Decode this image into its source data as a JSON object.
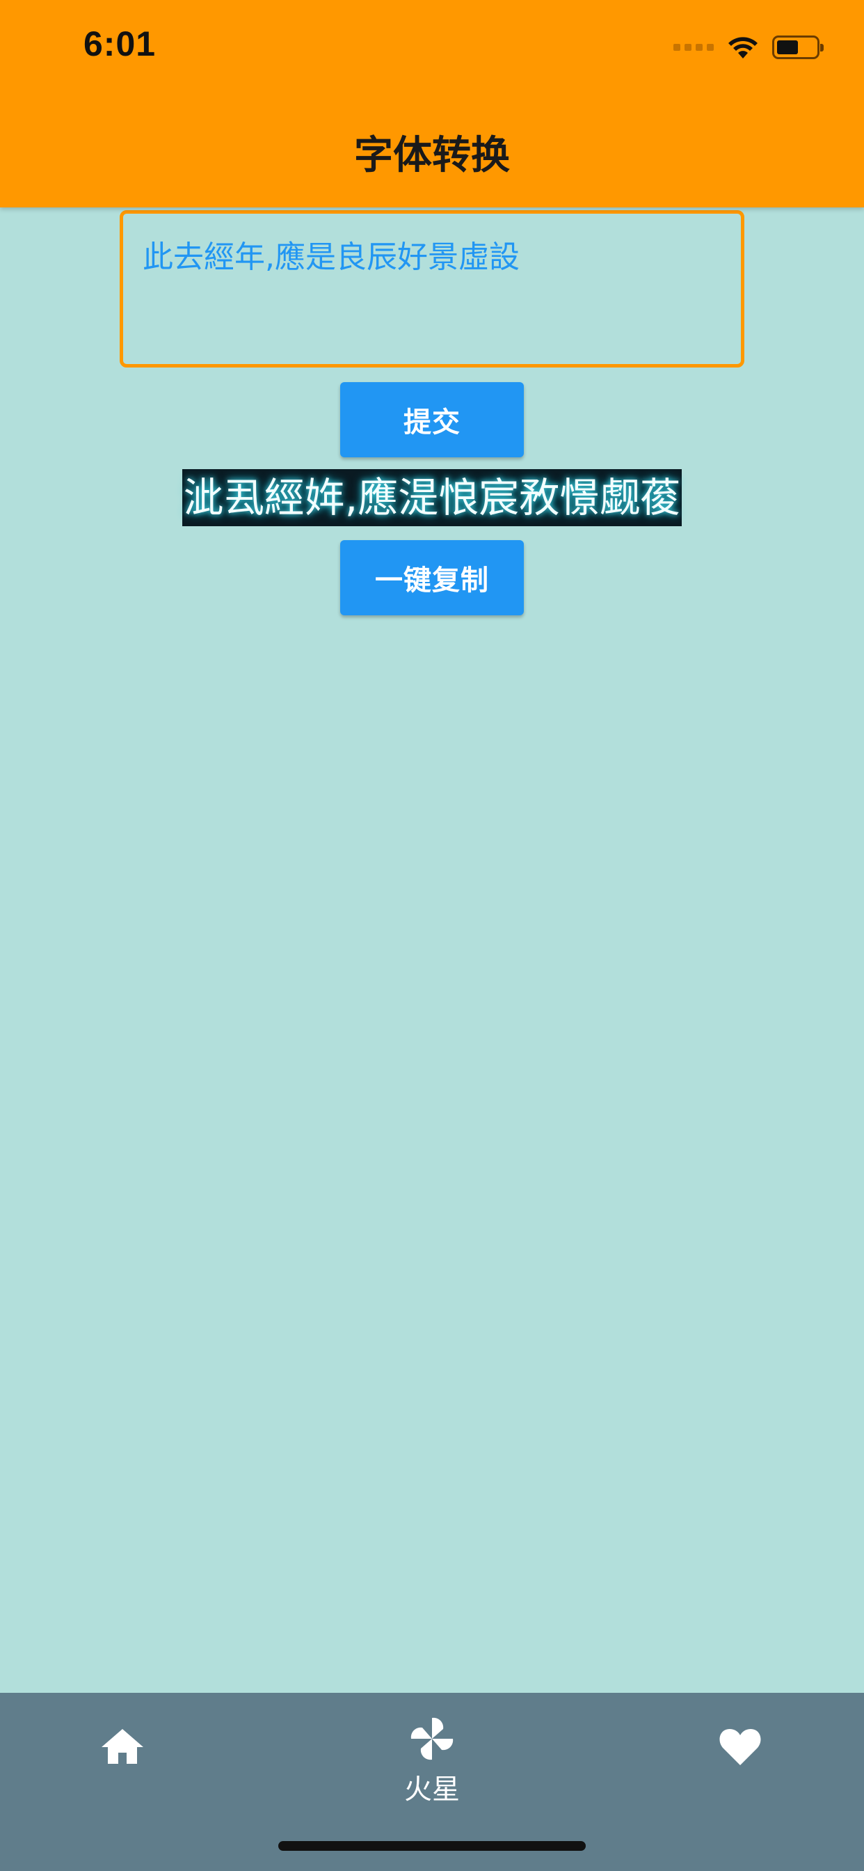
{
  "status_bar": {
    "time": "6:01",
    "icons": [
      "signal-dots-icon",
      "wifi-icon",
      "battery-icon"
    ]
  },
  "header": {
    "title": "字体转换",
    "background": "#FF9800"
  },
  "input": {
    "value": "此去經年,應是良辰好景虛設",
    "border_color": "#FF9800",
    "text_color": "#2196F3"
  },
  "buttons": {
    "submit_label": "提交",
    "copy_label": "一键复制",
    "color": "#2196F3"
  },
  "result": {
    "text": "泚厾經姩,應湜悢宸敄憬觑葰"
  },
  "bottom_nav": {
    "background": "#607D8B",
    "items": [
      {
        "icon": "home-icon",
        "label": ""
      },
      {
        "icon": "pinwheel-icon",
        "label": "火星"
      },
      {
        "icon": "heart-icon",
        "label": ""
      }
    ]
  },
  "page_background": "#B2DFDB"
}
